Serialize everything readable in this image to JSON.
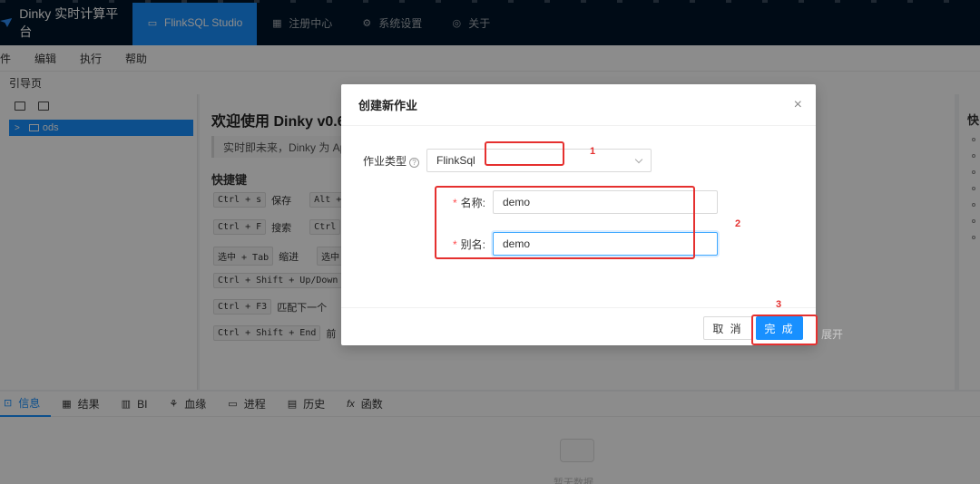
{
  "nav": {
    "brand": "Dinky 实时计算平台",
    "items": [
      {
        "label": "FlinkSQL Studio",
        "icon": "monitor-icon",
        "active": true
      },
      {
        "label": "注册中心",
        "icon": "grid-icon"
      },
      {
        "label": "系统设置",
        "icon": "gear-icon"
      },
      {
        "label": "关于",
        "icon": "check-circle-icon"
      }
    ]
  },
  "menubar": [
    "件",
    "编辑",
    "执行",
    "帮助"
  ],
  "subbar": {
    "label": "引导页"
  },
  "tree": {
    "node_label": "ods",
    "chevron": ">"
  },
  "welcome": {
    "title": "欢迎使用 Dinky v0.6",
    "intro": "实时即未来，Dinky 为 Apa",
    "shortcut_heading": "快捷键",
    "shortcuts": [
      {
        "key": "Ctrl + s",
        "desc": "保存",
        "key2": "Alt +"
      },
      {
        "key": "Ctrl + F",
        "desc": "搜索",
        "key2": "Ctrl"
      },
      {
        "key": "选中 + Tab",
        "desc": "缩进",
        "key2": "选中"
      },
      {
        "key": "Ctrl + Shift + Up/Down",
        "desc": "",
        "key2": ""
      },
      {
        "key": "Ctrl + F3",
        "desc": "匹配下一个",
        "key2": ""
      },
      {
        "key": "Ctrl + Shift + End",
        "desc": "前",
        "key2": ""
      }
    ]
  },
  "rightpanel": {
    "head": "快"
  },
  "bottom_tabs": [
    {
      "label": "信息",
      "icon": "terminal-icon",
      "active": true
    },
    {
      "label": "结果",
      "icon": "table-icon"
    },
    {
      "label": "BI",
      "icon": "bar-chart-icon"
    },
    {
      "label": "血缘",
      "icon": "lineage-icon"
    },
    {
      "label": "进程",
      "icon": "desktop-icon"
    },
    {
      "label": "历史",
      "icon": "calendar-icon"
    },
    {
      "label": "函数",
      "icon": "function-icon"
    }
  ],
  "empty": {
    "text": "暂无数据"
  },
  "outside_text": "展开",
  "modal": {
    "title": "创建新作业",
    "close": "×",
    "job_type": {
      "label": "作业类型",
      "value": "FlinkSql"
    },
    "name": {
      "label": "名称:",
      "value": "demo"
    },
    "alias": {
      "label": "别名:",
      "value": "demo"
    },
    "cancel": "取 消",
    "ok": "完 成"
  },
  "annotations": [
    "1",
    "2",
    "3"
  ],
  "colors": {
    "accent": "#1890ff",
    "nav_bg": "#001529",
    "annotation": "#e5302f"
  }
}
